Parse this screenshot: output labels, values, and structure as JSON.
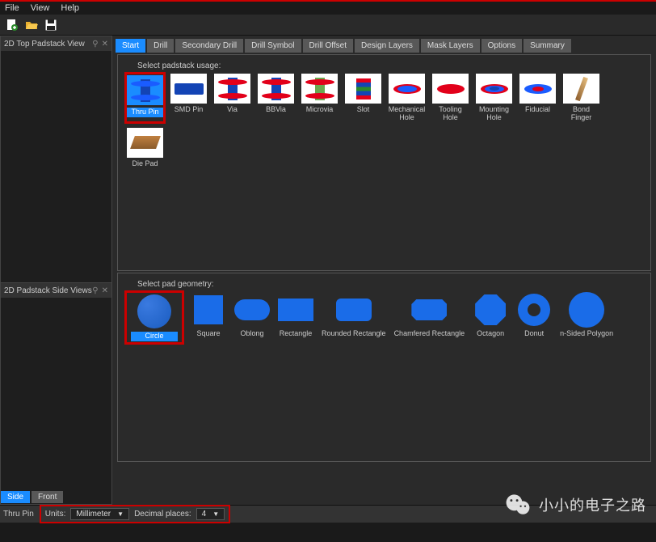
{
  "menu": {
    "file": "File",
    "view": "View",
    "help": "Help"
  },
  "panels": {
    "top": {
      "title": "2D Top Padstack View",
      "pin": "⚲",
      "close": "✕"
    },
    "side": {
      "title": "2D Padstack Side Views",
      "pin": "⚲",
      "close": "✕"
    }
  },
  "tabs": [
    {
      "label": "Start",
      "active": true
    },
    {
      "label": "Drill",
      "active": false
    },
    {
      "label": "Secondary Drill",
      "active": false
    },
    {
      "label": "Drill Symbol",
      "active": false
    },
    {
      "label": "Drill Offset",
      "active": false
    },
    {
      "label": "Design Layers",
      "active": false
    },
    {
      "label": "Mask Layers",
      "active": false
    },
    {
      "label": "Options",
      "active": false
    },
    {
      "label": "Summary",
      "active": false
    }
  ],
  "usage": {
    "heading": "Select padstack usage:",
    "items": [
      {
        "label": "Thru Pin",
        "selected": true,
        "shape": "spool-blue"
      },
      {
        "label": "SMD Pin",
        "selected": false,
        "shape": "smd"
      },
      {
        "label": "Via",
        "selected": false,
        "shape": "spool"
      },
      {
        "label": "BBVia",
        "selected": false,
        "shape": "spool"
      },
      {
        "label": "Microvia",
        "selected": false,
        "shape": "spool-green"
      },
      {
        "label": "Slot",
        "selected": false,
        "shape": "slot"
      },
      {
        "label": "Mechanical Hole",
        "selected": false,
        "shape": "mech"
      },
      {
        "label": "Tooling Hole",
        "selected": false,
        "shape": "tool"
      },
      {
        "label": "Mounting Hole",
        "selected": false,
        "shape": "mount"
      },
      {
        "label": "Fiducial",
        "selected": false,
        "shape": "fid"
      },
      {
        "label": "Bond Finger",
        "selected": false,
        "shape": "bond"
      },
      {
        "label": "Die Pad",
        "selected": false,
        "shape": "diepad"
      }
    ]
  },
  "geometry": {
    "heading": "Select pad geometry:",
    "items": [
      {
        "label": "Circle",
        "selected": true,
        "cls": "g-circle"
      },
      {
        "label": "Square",
        "selected": false,
        "cls": "g-square"
      },
      {
        "label": "Oblong",
        "selected": false,
        "cls": "g-oblong"
      },
      {
        "label": "Rectangle",
        "selected": false,
        "cls": "g-rect"
      },
      {
        "label": "Rounded Rectangle",
        "selected": false,
        "cls": "g-rrect"
      },
      {
        "label": "Chamfered Rectangle",
        "selected": false,
        "cls": "g-cham"
      },
      {
        "label": "Octagon",
        "selected": false,
        "cls": "g-oct"
      },
      {
        "label": "Donut",
        "selected": false,
        "cls": "g-donut"
      },
      {
        "label": "n-Sided Polygon",
        "selected": false,
        "cls": "g-poly"
      }
    ]
  },
  "bottomTabs": [
    {
      "label": "Side",
      "active": true
    },
    {
      "label": "Front",
      "active": false
    }
  ],
  "status": {
    "type": "Thru Pin",
    "unitsLabel": "Units:",
    "unitsValue": "Millimeter",
    "decimalLabel": "Decimal places:",
    "decimalValue": "4"
  },
  "watermark": "小小的电子之路"
}
